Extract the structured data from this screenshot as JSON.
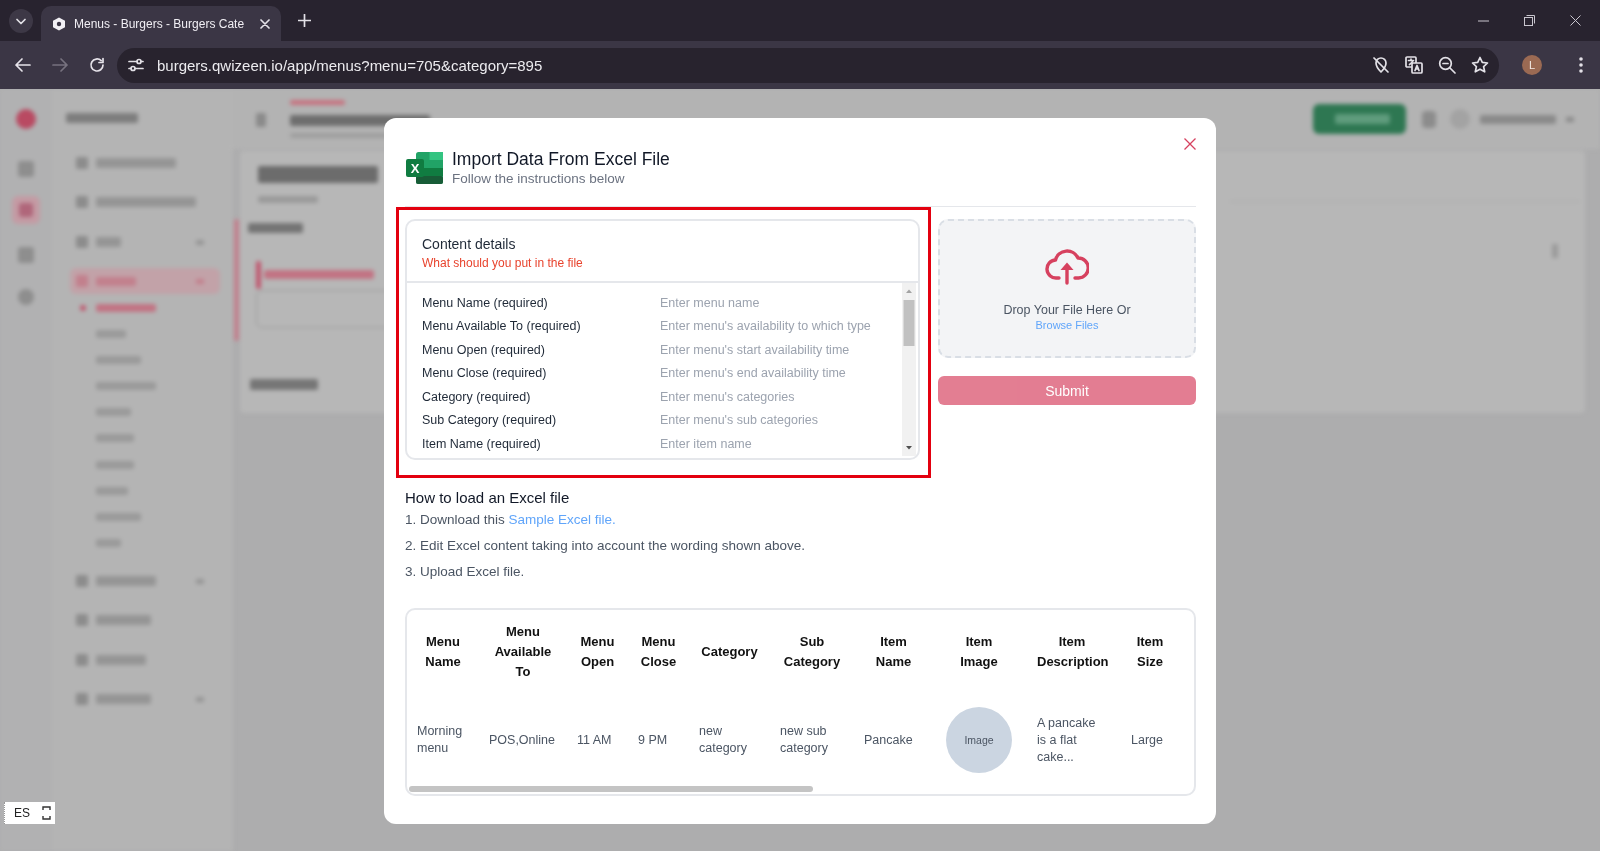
{
  "browser": {
    "tabs": [
      {
        "title": "Menus - Burgers - Burgers Cate",
        "selected": true
      }
    ],
    "nav": [
      {
        "kind": "back",
        "disabled": false
      },
      {
        "kind": "forward",
        "disabled": true
      },
      {
        "kind": "reload",
        "disabled": false
      }
    ],
    "url": "burgers.qwizeen.io/app/menus?menu=705&category=895",
    "profile": {
      "initial": "L"
    }
  },
  "dialog": {
    "icon_letter": "X",
    "title": "Import Data From Excel File",
    "subtitle": "Follow the instructions below",
    "content_details": {
      "title": "Content details",
      "subtitle": "What should you put in the file",
      "highlighted": true,
      "rows": [
        {
          "field": "Menu Name (required)",
          "hint": "Enter menu name"
        },
        {
          "field": "Menu Available To (required)",
          "hint": "Enter menu's availability to which type"
        },
        {
          "field": "Menu Open (required)",
          "hint": "Enter menu's start availability time"
        },
        {
          "field": "Menu Close (required)",
          "hint": "Enter menu's end availability time"
        },
        {
          "field": "Category (required)",
          "hint": "Enter menu's categories"
        },
        {
          "field": "Sub Category (required)",
          "hint": "Enter menu's sub categories"
        },
        {
          "field": "Item Name (required)",
          "hint": "Enter item name"
        }
      ]
    },
    "upload": {
      "text": "Drop Your File Here Or",
      "link": "Browse Files"
    },
    "submit": {
      "label": "Submit",
      "disabled": true
    },
    "instructions": {
      "title": "How to load an Excel file",
      "steps": [
        {
          "text": "1. Download this ",
          "link": "Sample Excel file."
        },
        {
          "text": "2. Edit Excel content taking into account the wording shown above."
        },
        {
          "text": "3. Upload Excel file."
        }
      ]
    },
    "sample_table": {
      "columns": [
        "Menu Name",
        "Menu Available To",
        "Menu Open",
        "Menu Close",
        "Category",
        "Sub Category",
        "Item Name",
        "Item Image",
        "Item Description",
        "Item Size"
      ],
      "rows": [
        [
          {
            "kind": "text",
            "text": "Morning menu"
          },
          {
            "kind": "text",
            "text": "POS,Online"
          },
          {
            "kind": "text",
            "text": "11 AM"
          },
          {
            "kind": "text",
            "text": "9 PM"
          },
          {
            "kind": "text",
            "text": "new category"
          },
          {
            "kind": "text",
            "text": "new sub category"
          },
          {
            "kind": "text",
            "text": "Pancake"
          },
          {
            "kind": "image",
            "text": "Image"
          },
          {
            "kind": "text",
            "text": "A pancake is a flat cake..."
          },
          {
            "kind": "text",
            "text": "Large"
          }
        ]
      ]
    }
  },
  "language_widget": {
    "label": "ES"
  }
}
